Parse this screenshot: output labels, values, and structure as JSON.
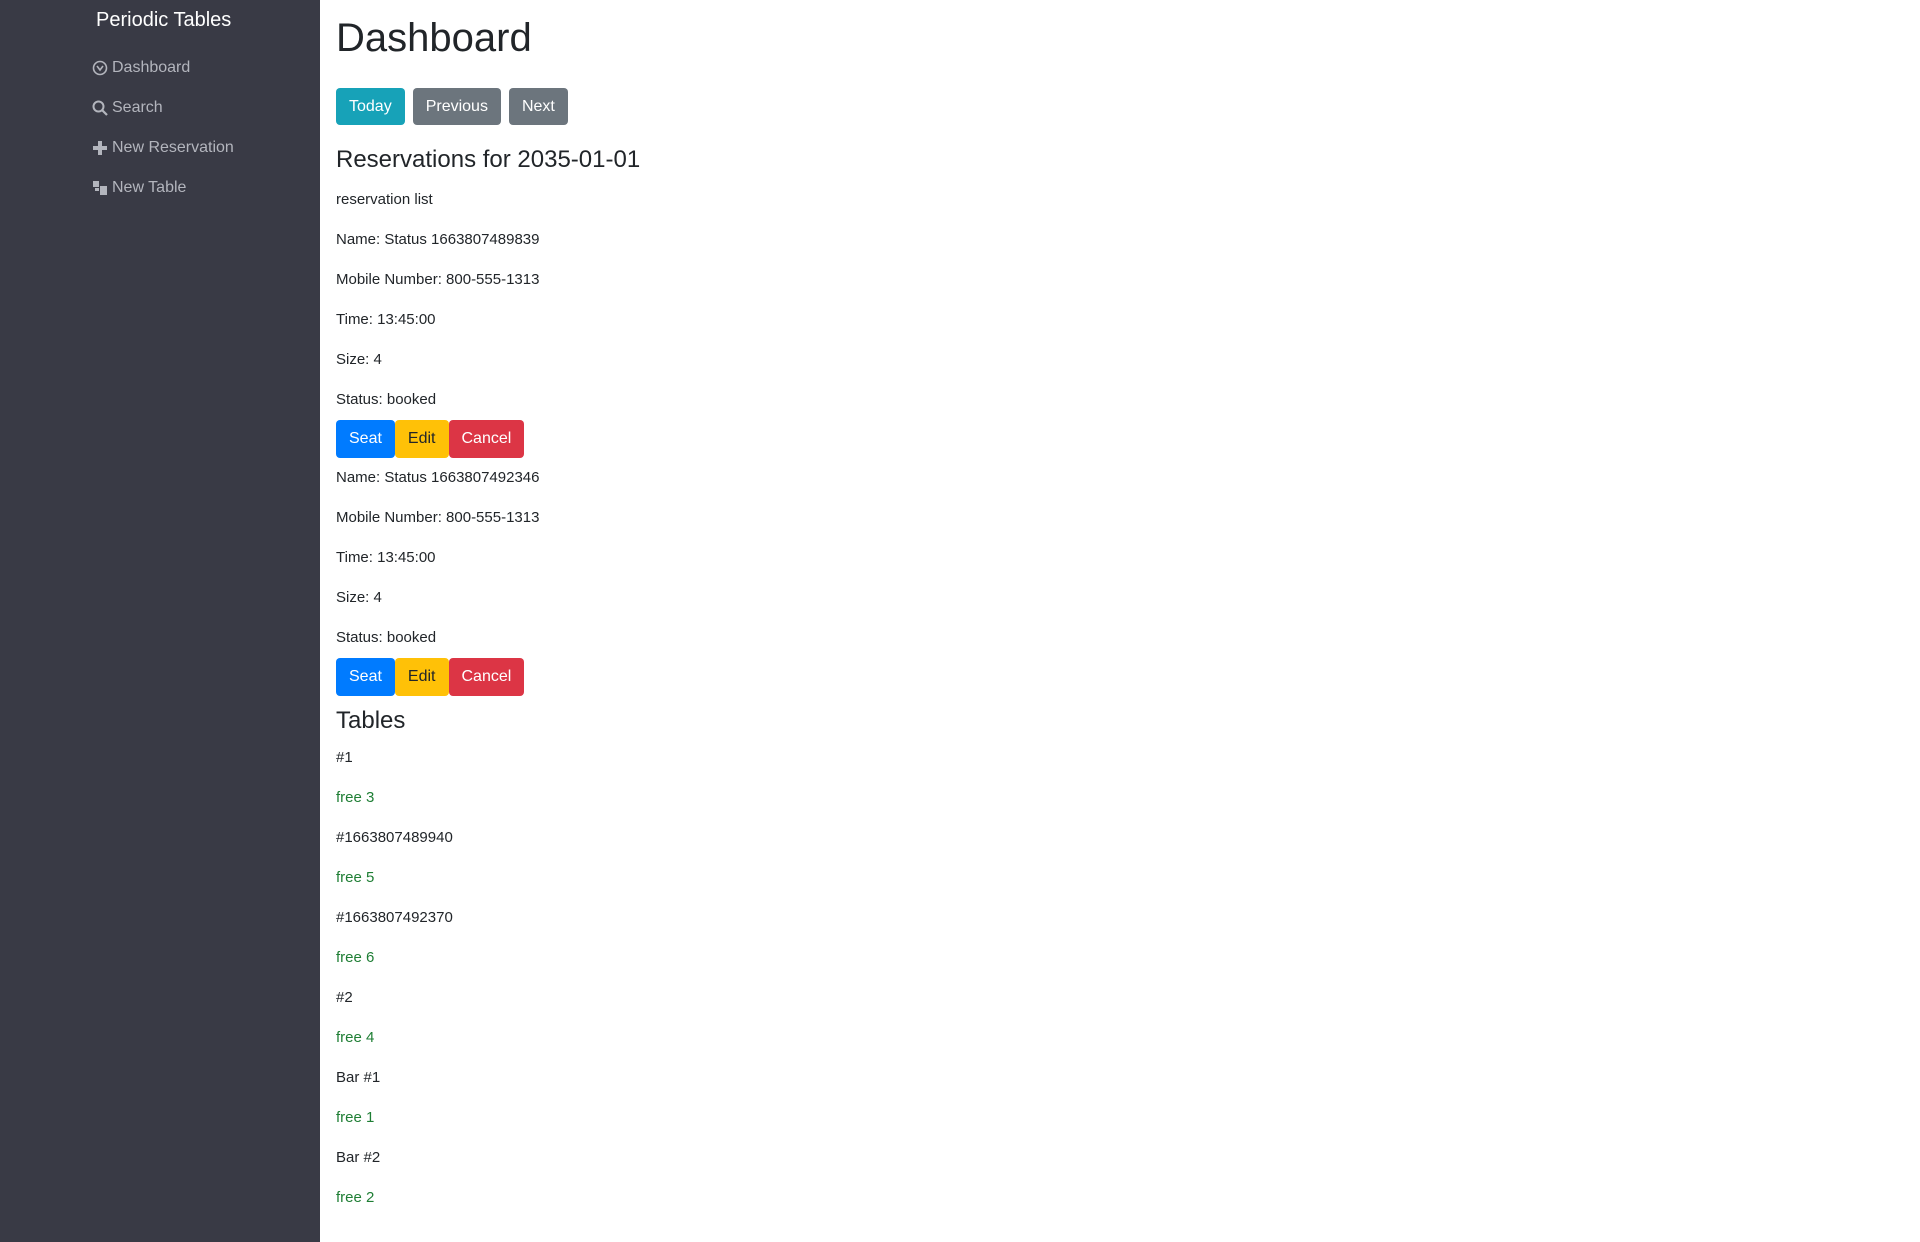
{
  "sidebar": {
    "brand": "Periodic Tables",
    "items": [
      {
        "label": "Dashboard",
        "icon": "dashboard-icon"
      },
      {
        "label": "Search",
        "icon": "search-icon"
      },
      {
        "label": "New Reservation",
        "icon": "plus-icon"
      },
      {
        "label": "New Table",
        "icon": "table-icon"
      }
    ]
  },
  "main": {
    "title": "Dashboard",
    "buttons": {
      "today": "Today",
      "previous": "Previous",
      "next": "Next"
    },
    "reservations_heading": "Reservations for 2035-01-01",
    "reservation_list_label": "reservation list",
    "reservations": [
      {
        "name": "Name: Status 1663807489839",
        "mobile": "Mobile Number: 800-555-1313",
        "time": "Time: 13:45:00",
        "size": "Size: 4",
        "status": "Status: booked"
      },
      {
        "name": "Name: Status 1663807492346",
        "mobile": "Mobile Number: 800-555-1313",
        "time": "Time: 13:45:00",
        "size": "Size: 4",
        "status": "Status: booked"
      }
    ],
    "reservation_actions": {
      "seat": "Seat",
      "edit": "Edit",
      "cancel": "Cancel"
    },
    "tables_heading": "Tables",
    "tables": [
      {
        "name": "#1",
        "status": "free 3"
      },
      {
        "name": "#1663807489940",
        "status": "free 5"
      },
      {
        "name": "#1663807492370",
        "status": "free 6"
      },
      {
        "name": "#2",
        "status": "free 4"
      },
      {
        "name": "Bar #1",
        "status": "free 1"
      },
      {
        "name": "Bar #2",
        "status": "free 2"
      }
    ]
  },
  "colors": {
    "sidebar_bg": "#393a45",
    "today": "#17a2b8",
    "secondary": "#6c757d",
    "seat": "#007bff",
    "edit": "#ffc107",
    "cancel": "#dc3545",
    "free": "#28a745"
  }
}
